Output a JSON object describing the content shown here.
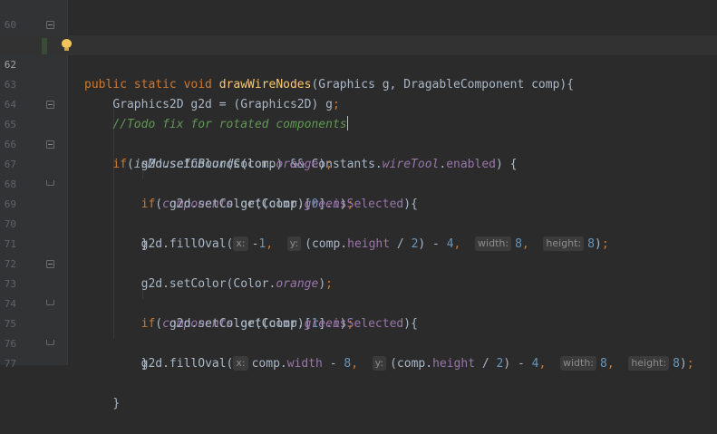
{
  "editor": {
    "current_line": "62",
    "colors": {
      "background": "#2b2b2b",
      "gutter": "#313335",
      "keyword": "#cc7832",
      "method_decl": "#ffc66d",
      "comment": "#629755",
      "field": "#9876aa",
      "number": "#6897bb",
      "text": "#a9b7c6"
    },
    "lines": [
      {
        "num": "60"
      },
      {
        "num": "61",
        "indent": "",
        "p": [
          "public static void ",
          "drawWireNodes",
          "(Graphics g, DragableComponent comp){"
        ]
      },
      {
        "num": "62",
        "indent": "    ",
        "p": [
          "//Todo fix for rotated components"
        ]
      },
      {
        "num": "63",
        "indent": "    ",
        "p": [
          "Graphics2D g2d = (Graphics2D) g",
          ";"
        ]
      },
      {
        "num": "64"
      },
      {
        "num": "65",
        "indent": "    ",
        "p": [
          "if",
          "(",
          "isMouseInBounds",
          "(comp) && Constants.",
          "wireTool",
          ".",
          "enabled",
          ") {"
        ]
      },
      {
        "num": "66",
        "indent": "        ",
        "p": [
          "g2d.setColor(Color.",
          "orange",
          ")",
          ";"
        ]
      },
      {
        "num": "67",
        "indent": "        ",
        "p": [
          "if",
          "(",
          "components",
          ".get(comp)[",
          "0",
          "].",
          "isSelected",
          "){"
        ]
      },
      {
        "num": "68",
        "indent": "            ",
        "p": [
          "g2d.setColor(Color.",
          "green",
          ")",
          ";"
        ]
      },
      {
        "num": "69",
        "indent": "        ",
        "p": [
          "}"
        ]
      },
      {
        "num": "70",
        "indent": "        ",
        "p": [
          "g2d.fillOval(",
          "x:",
          "-",
          "1",
          ",  ",
          "y:",
          "(comp.",
          "height",
          " / ",
          "2",
          ") - ",
          "4",
          ",  ",
          "width:",
          "8",
          ",  ",
          "height:",
          "8",
          ")",
          ";"
        ]
      },
      {
        "num": "71"
      },
      {
        "num": "72",
        "indent": "        ",
        "p": [
          "g2d.setColor(Color.",
          "orange",
          ")",
          ";"
        ]
      },
      {
        "num": "73",
        "indent": "        ",
        "p": [
          "if",
          "(",
          "components",
          ".get(comp)[",
          "1",
          "].",
          "isSelected",
          "){"
        ]
      },
      {
        "num": "74",
        "indent": "            ",
        "p": [
          "g2d.setColor(Color.",
          "green",
          ")",
          ";"
        ]
      },
      {
        "num": "75",
        "indent": "        ",
        "p": [
          "}"
        ]
      },
      {
        "num": "76",
        "indent": "        ",
        "p": [
          "g2d.fillOval(",
          "x:",
          "comp.",
          "width",
          " - ",
          "8",
          ",  ",
          "y:",
          "(comp.",
          "height",
          " / ",
          "2",
          ") - ",
          "4",
          ",  ",
          "width:",
          "8",
          ",  ",
          "height:",
          "8",
          ")",
          ";"
        ]
      },
      {
        "num": "77",
        "indent": "    ",
        "p": [
          "}"
        ]
      }
    ]
  }
}
